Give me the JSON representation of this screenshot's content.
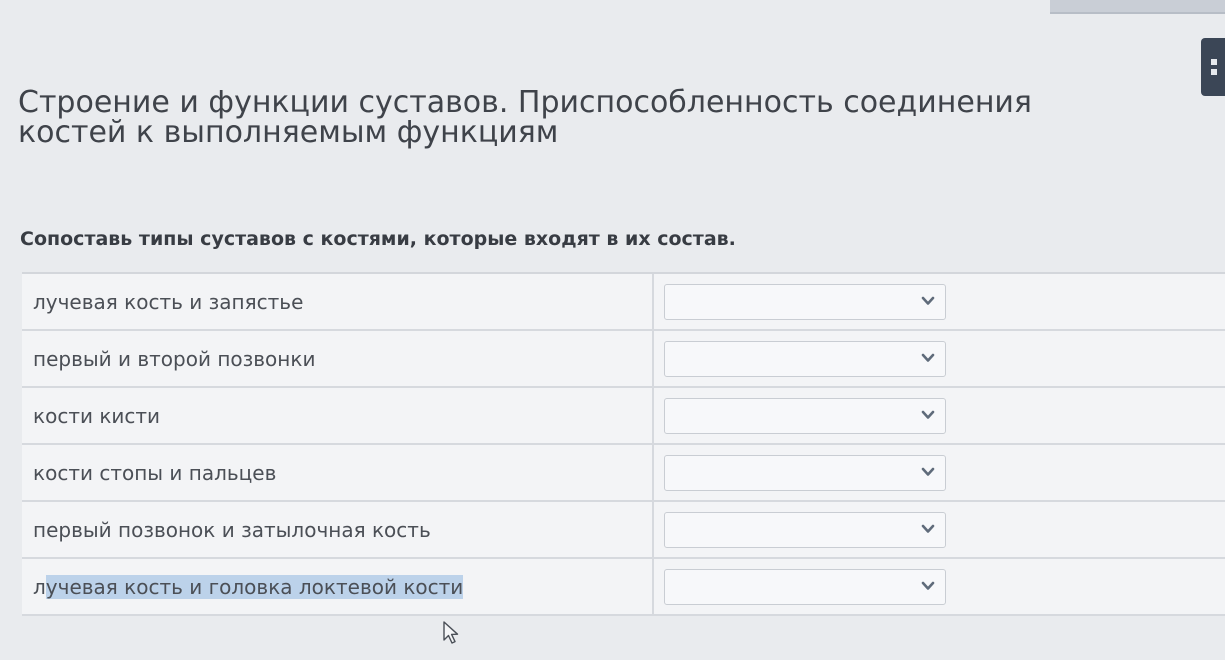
{
  "page": {
    "title": "Строение и функции суставов. Приспособленность соединения костей к выполняемым функциям"
  },
  "task": {
    "instruction": "Сопоставь типы суставов с костями, которые входят в их состав."
  },
  "rows": [
    {
      "label": "лучевая кость и запястье",
      "selected_value": ""
    },
    {
      "label": "первый и второй позвонки",
      "selected_value": ""
    },
    {
      "label": "кости кисти",
      "selected_value": ""
    },
    {
      "label": "кости стопы и пальцев",
      "selected_value": ""
    },
    {
      "label": "первый позвонок и затылочная кость",
      "selected_value": ""
    },
    {
      "label_plain": "л",
      "label_selected": "учевая кость и головка локтевой кости",
      "selected_value": ""
    }
  ],
  "icons": {
    "dropdown": "chevron-down-icon",
    "cursor": "mouse-pointer-icon",
    "menu": "menu-icon"
  },
  "colors": {
    "background": "#e9ebee",
    "text_selection": "#bcd2ea",
    "chevron": "#5f6b7a",
    "side_tab": "#3b4656"
  }
}
